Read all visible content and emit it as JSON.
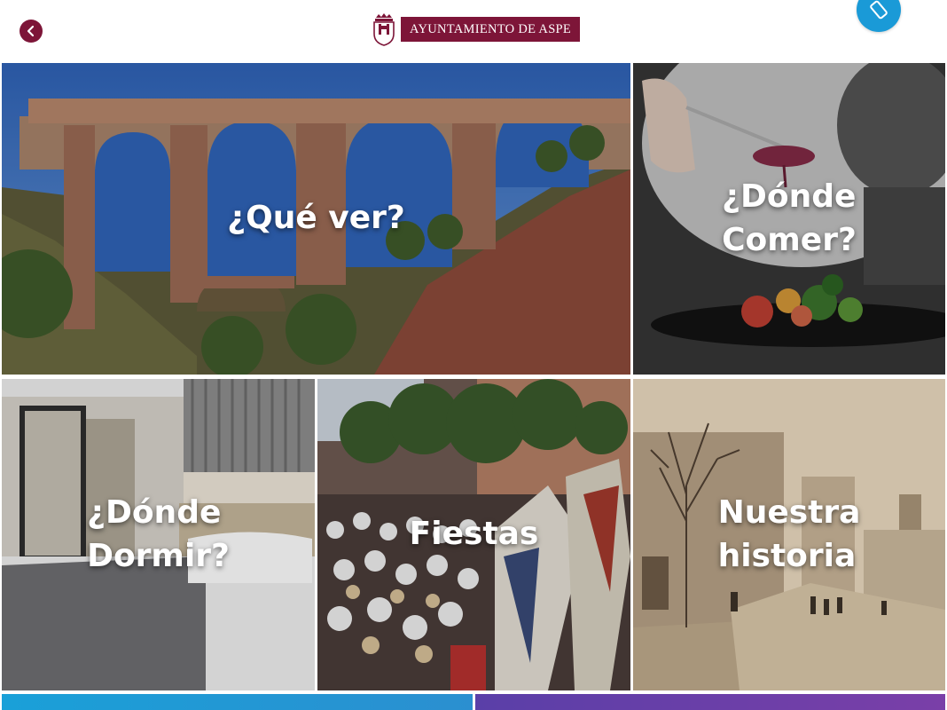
{
  "header": {
    "logo_text": "AYUNTAMIENTO DE ASPE",
    "back_icon": "chevron-left-icon",
    "rotate_icon": "screen-rotation-icon",
    "brand_color": "#7d1538",
    "accent_color": "#1a9ad7"
  },
  "tiles": [
    {
      "label": "¿Qué ver?"
    },
    {
      "label": "¿Dónde\nComer?"
    },
    {
      "label": "¿Dónde\nDormir?"
    },
    {
      "label": "Fiestas"
    },
    {
      "label": "Nuestra\nhistoria"
    }
  ]
}
